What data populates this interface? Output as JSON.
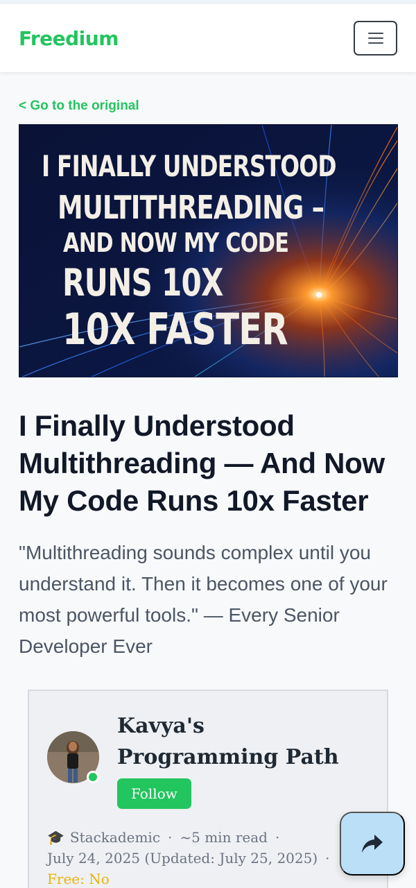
{
  "header": {
    "brand": "Freedium"
  },
  "nav": {
    "back_link": "< Go to the original"
  },
  "hero": {
    "lines": [
      "I FINALLY UNDERSTOOD",
      "MULTITHREADING –",
      "AND NOW MY CODE",
      "RUNS 10X",
      "10X FASTER"
    ]
  },
  "article": {
    "title": "I Finally Understood Multithreading — And Now My Code Runs 10x Faster",
    "subtitle": "\"Multithreading sounds complex until you understand it. Then it becomes one of your most powerful tools.\" — Every Senior Developer Ever"
  },
  "author": {
    "name": "Kavya's Programming Path",
    "follow_label": "Follow",
    "publication": "Stackademic",
    "read_time": "~5 min read",
    "date": "July 24, 2025 (Updated: July 25, 2025)",
    "free_status": "Free: No"
  },
  "colors": {
    "brand_green": "#22c55e",
    "free_status": "#eab308"
  },
  "icons": {
    "menu": "hamburger-icon",
    "publication": "graduation-cap-icon",
    "share": "share-arrow-icon"
  }
}
